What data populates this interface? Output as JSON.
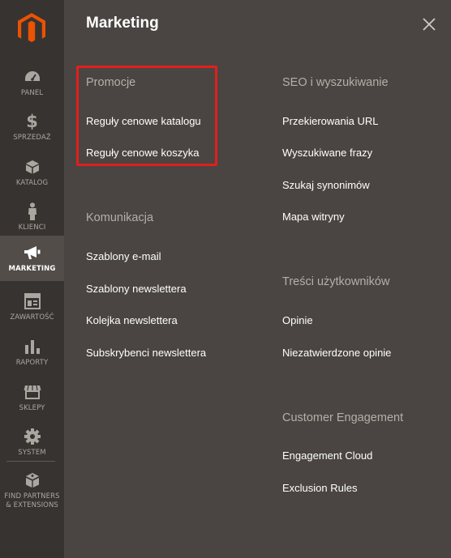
{
  "sidebar": {
    "items": [
      {
        "label": "PANEL",
        "icon": "dashboard-icon"
      },
      {
        "label": "SPRZEDAŻ",
        "icon": "dollar-icon"
      },
      {
        "label": "KATALOG",
        "icon": "box-icon"
      },
      {
        "label": "KLIENCI",
        "icon": "person-icon"
      },
      {
        "label": "MARKETING",
        "icon": "megaphone-icon",
        "active": true
      },
      {
        "label": "ZAWARTOŚĆ",
        "icon": "layout-icon"
      },
      {
        "label": "RAPORTY",
        "icon": "bar-chart-icon"
      },
      {
        "label": "SKLEPY",
        "icon": "store-icon"
      },
      {
        "label": "SYSTEM",
        "icon": "gear-icon"
      },
      {
        "label": "FIND PARTNERS & EXTENSIONS",
        "icon": "blocks-icon"
      }
    ]
  },
  "panel": {
    "title": "Marketing",
    "sections": {
      "promocje": {
        "title": "Promocje",
        "links": [
          "Reguły cenowe katalogu",
          "Reguły cenowe koszyka"
        ]
      },
      "komunikacja": {
        "title": "Komunikacja",
        "links": [
          "Szablony e-mail",
          "Szablony newslettera",
          "Kolejka newslettera",
          "Subskrybenci newslettera"
        ]
      },
      "seo": {
        "title": "SEO i wyszukiwanie",
        "links": [
          "Przekierowania URL",
          "Wyszukiwane frazy",
          "Szukaj synonimów",
          "Mapa witryny"
        ]
      },
      "tresci": {
        "title": "Treści użytkowników",
        "links": [
          "Opinie",
          "Niezatwierdzone opinie"
        ]
      },
      "engagement": {
        "title": "Customer Engagement",
        "links": [
          "Engagement Cloud",
          "Exclusion Rules"
        ]
      }
    }
  },
  "colors": {
    "brand": "#eb5202",
    "highlight": "#e0201c"
  }
}
